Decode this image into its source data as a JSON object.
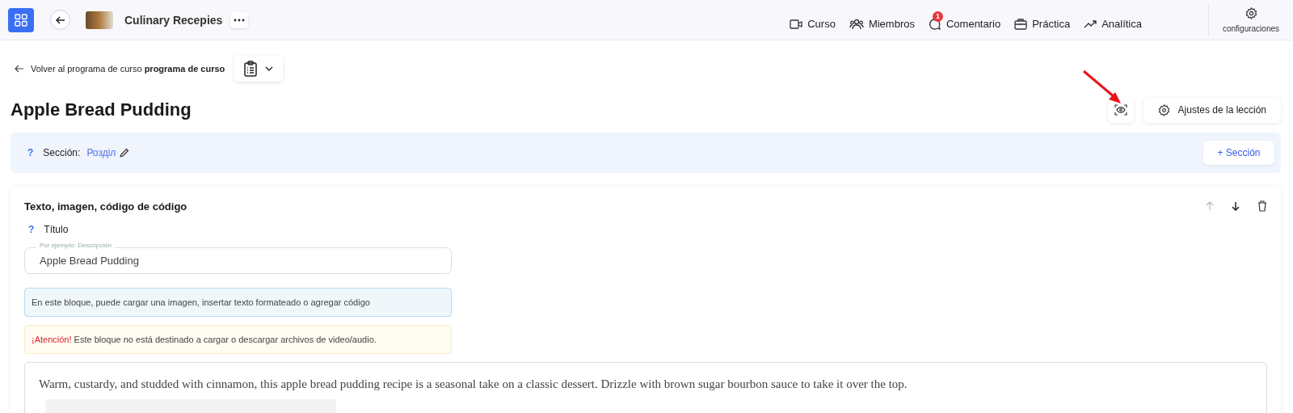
{
  "header": {
    "course_title": "Culinary Recepies",
    "nav": [
      {
        "label": "Curso"
      },
      {
        "label": "Miembros"
      },
      {
        "label": "Comentario",
        "badge": "1"
      },
      {
        "label": "Práctica"
      },
      {
        "label": "Analítica"
      }
    ],
    "settings_label": "configuraciones"
  },
  "breadcrumb": {
    "text": "Volver al programa de curso **programa de curso**"
  },
  "page_title": "Apple Bread Pudding",
  "lesson_settings_button": "Ajustes de la lección",
  "section": {
    "help": "?",
    "label": "Sección:",
    "value": "Розділ",
    "add_button": "+ Sección"
  },
  "block": {
    "title": "Texto, imagen, código de código",
    "field": {
      "help": "?",
      "label": "Título",
      "placeholder": "Por ejemplo: Descripción",
      "value": "Apple Bread Pudding"
    },
    "info": "En este bloque, puede cargar una imagen, insertar texto formateado o agregar código",
    "warning": {
      "emphasis": "¡Atención!",
      "text": "Este bloque no está destinado a cargar o descargar archivos de video/audio."
    },
    "content": "Warm, custardy, and studded with cinnamon, this apple bread pudding recipe is a seasonal take on a classic dessert. Drizzle with brown sugar bourbon sauce to take it over the top."
  }
}
